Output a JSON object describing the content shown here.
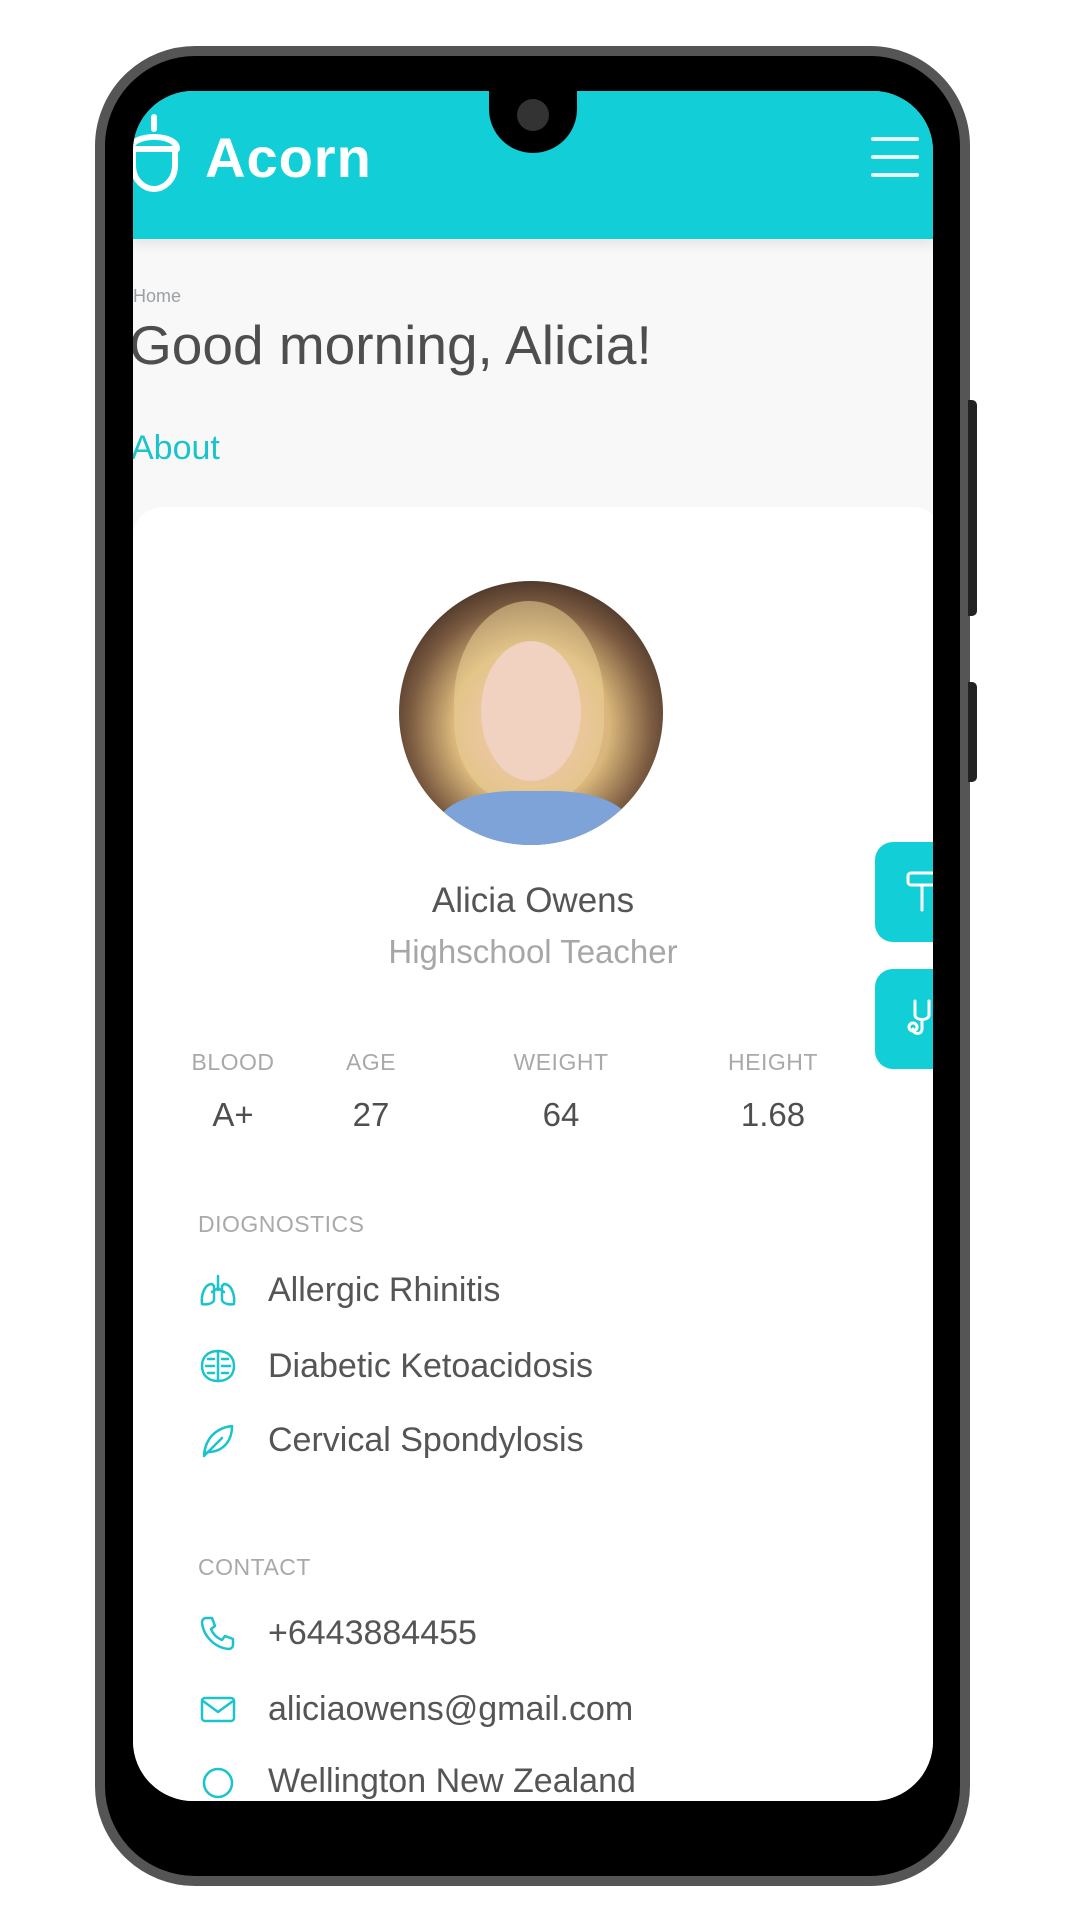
{
  "header": {
    "brand": "Acorn"
  },
  "breadcrumb": "Home",
  "greeting": "Good morning, Alicia!",
  "section_link": "About",
  "profile": {
    "name": "Alicia Owens",
    "role": "Highschool Teacher"
  },
  "stats": [
    {
      "label": "BLOOD",
      "value": "A+"
    },
    {
      "label": "AGE",
      "value": "27"
    },
    {
      "label": "WEIGHT",
      "value": "64"
    },
    {
      "label": "HEIGHT",
      "value": "1.68"
    }
  ],
  "diagnostics": {
    "heading": "DIOGNOSTICS",
    "items": [
      {
        "label": "Allergic Rhinitis",
        "icon": "lungs-icon"
      },
      {
        "label": "Diabetic Ketoacidosis",
        "icon": "brain-icon"
      },
      {
        "label": "Cervical Spondylosis",
        "icon": "leaf-icon"
      }
    ]
  },
  "contact": {
    "heading": "CONTACT",
    "items": [
      {
        "label": "+6443884455",
        "icon": "phone-icon"
      },
      {
        "label": "aliciaowens@gmail.com",
        "icon": "email-icon"
      },
      {
        "label": "Wellington New Zealand",
        "icon": "pin-icon"
      }
    ]
  },
  "colors": {
    "accent": "#12cfd7",
    "text": "#555555",
    "muted": "#a9a9a9"
  }
}
